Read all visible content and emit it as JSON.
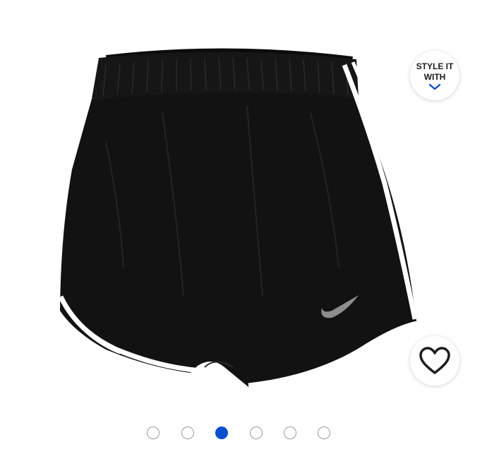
{
  "product": {
    "image_name": "black-running-shorts-image",
    "brand_mark": "nike-swoosh"
  },
  "style_it": {
    "line1": "STYLE IT",
    "line2": "WITH",
    "icon": "chevron-down-icon",
    "accent_color": "#0b4fd1"
  },
  "favorite": {
    "icon": "heart-outline-icon"
  },
  "carousel": {
    "slide_count": 6,
    "active_index": 2,
    "active_color": "#0b4fd1",
    "inactive_border_color": "#9a9a9a"
  }
}
